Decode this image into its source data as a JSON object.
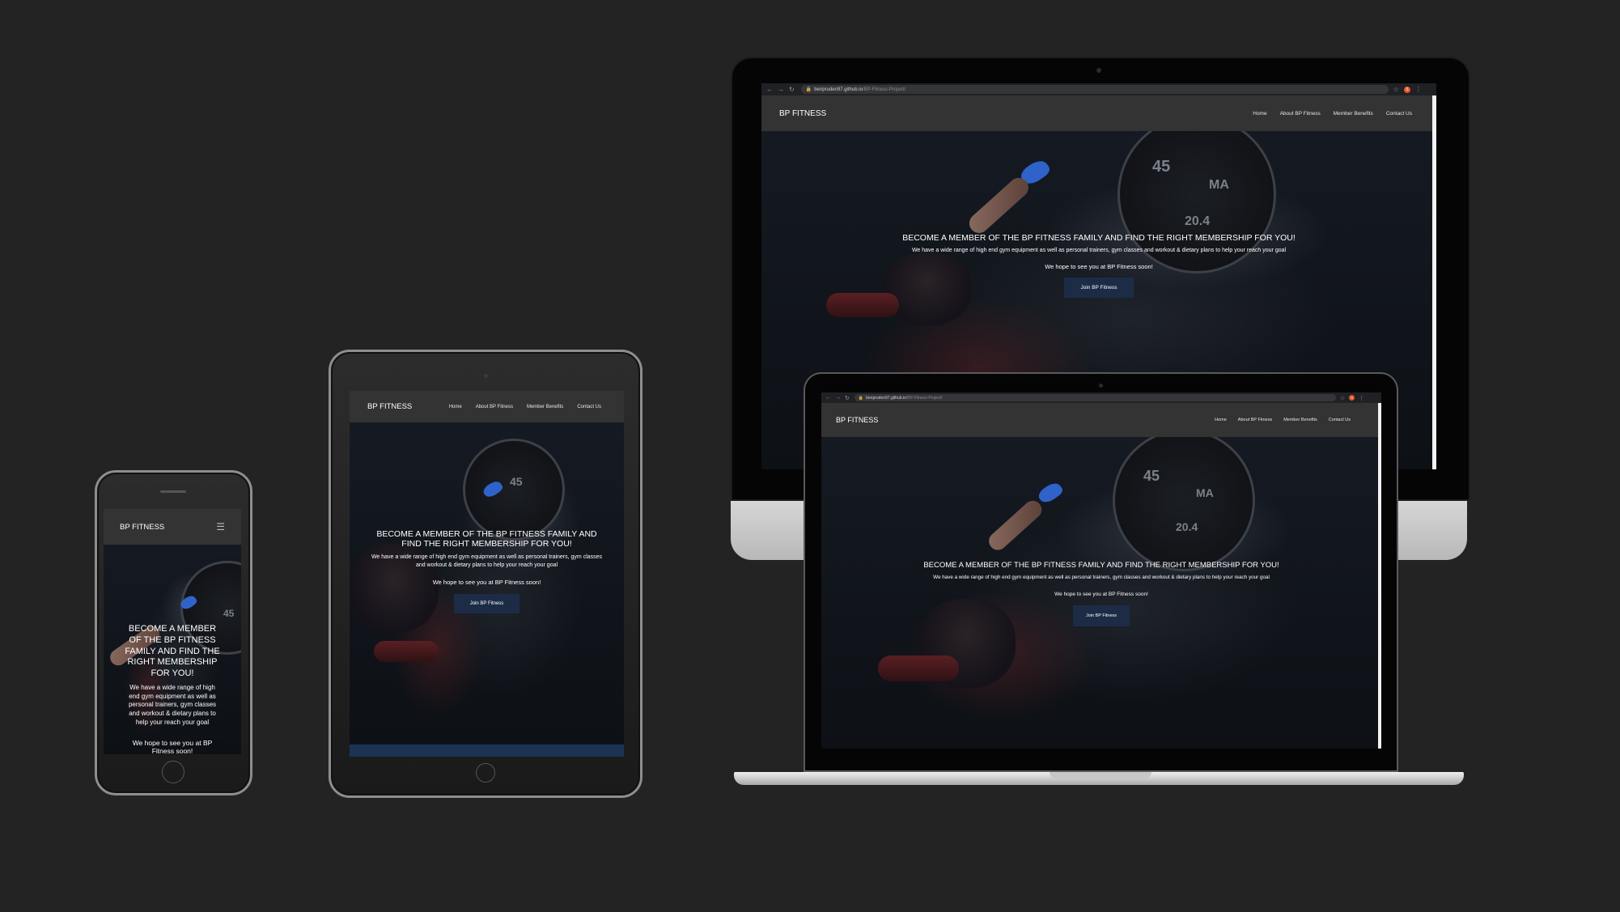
{
  "site": {
    "brand": "BP FITNESS",
    "nav": [
      "Home",
      "About BP Fitness",
      "Member Benefits",
      "Contact Us"
    ],
    "headline": "BECOME A MEMBER OF THE BP FITNESS FAMILY AND FIND THE RIGHT MEMBERSHIP FOR YOU!",
    "tablet_headline_line1": "BECOME A MEMBER OF THE BP FITNESS FAMILY AND",
    "tablet_headline_line2": "FIND THE RIGHT MEMBERSHIP FOR YOU!",
    "description": "We have a wide range of high end gym equipment as well as personal trainers, gym classes and workout & dietary plans to help your reach your goal",
    "closing": "We hope to see you at BP Fitness soon!",
    "cta": "Join BP Fitness",
    "plate_numbers": [
      "45",
      "MA",
      "20.4"
    ]
  },
  "phone": {
    "headline_lines": [
      "BECOME A MEMBER",
      "OF THE BP FITNESS",
      "FAMILY AND FIND THE",
      "RIGHT MEMBERSHIP",
      "FOR YOU!"
    ],
    "description_lines": [
      "We have a wide range of high",
      "end gym equipment as well as",
      "personal trainers, gym classes",
      "and workout & dietary plans to",
      "help your reach your goal"
    ],
    "closing_lines": [
      "We hope to see you at BP",
      "Fitness soon!"
    ]
  },
  "browser": {
    "url_host": "benpruden97.github.io",
    "url_path": "/BP-Fitness-Project/",
    "ext_badge": "S"
  },
  "colors": {
    "background": "#232323",
    "nav": "#333333",
    "cta": "#1c2c46",
    "accent_shoe": "#2f63c9"
  }
}
